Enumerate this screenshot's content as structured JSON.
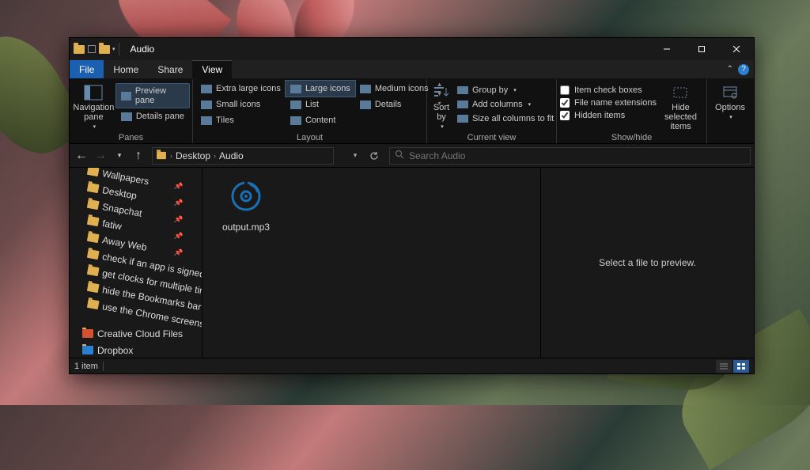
{
  "title": "Audio",
  "menutabs": {
    "file": "File",
    "home": "Home",
    "share": "Share",
    "view": "View"
  },
  "ribbon": {
    "panes": {
      "nav": "Navigation\npane",
      "preview": "Preview pane",
      "details": "Details pane",
      "label": "Panes"
    },
    "layout": {
      "items": [
        "Extra large icons",
        "Large icons",
        "Medium icons",
        "Small icons",
        "List",
        "Details",
        "Tiles",
        "Content"
      ],
      "selected": "Large icons",
      "label": "Layout"
    },
    "current": {
      "sort": "Sort\nby",
      "group": "Group by",
      "addcols": "Add columns",
      "sizeall": "Size all columns to fit",
      "label": "Current view"
    },
    "showhide": {
      "checkboxes": "Item check boxes",
      "ext": "File name extensions",
      "hidden": "Hidden items",
      "hide": "Hide selected\nitems",
      "label": "Show/hide"
    },
    "options": "Options"
  },
  "breadcrumb": [
    "Desktop",
    "Audio"
  ],
  "search_placeholder": "Search Audio",
  "tree": [
    {
      "name": "Wallpapers",
      "pin": true
    },
    {
      "name": "Desktop",
      "pin": true
    },
    {
      "name": "Snapchat",
      "pin": true
    },
    {
      "name": "fatiw",
      "pin": true
    },
    {
      "name": "Away Web",
      "pin": true
    },
    {
      "name": "check if an app is signed o",
      "pin": false
    },
    {
      "name": "get clocks for multiple tim",
      "pin": false
    },
    {
      "name": "hide the Bookmarks bar fro",
      "pin": false
    },
    {
      "name": "use the Chrome screensho",
      "pin": false
    }
  ],
  "tree_tail": [
    {
      "name": "Creative Cloud Files",
      "cls": "cc"
    },
    {
      "name": "Dropbox",
      "cls": "db"
    }
  ],
  "file": {
    "name": "output.mp3"
  },
  "preview_msg": "Select a file to preview.",
  "status": {
    "count": "1 item"
  }
}
